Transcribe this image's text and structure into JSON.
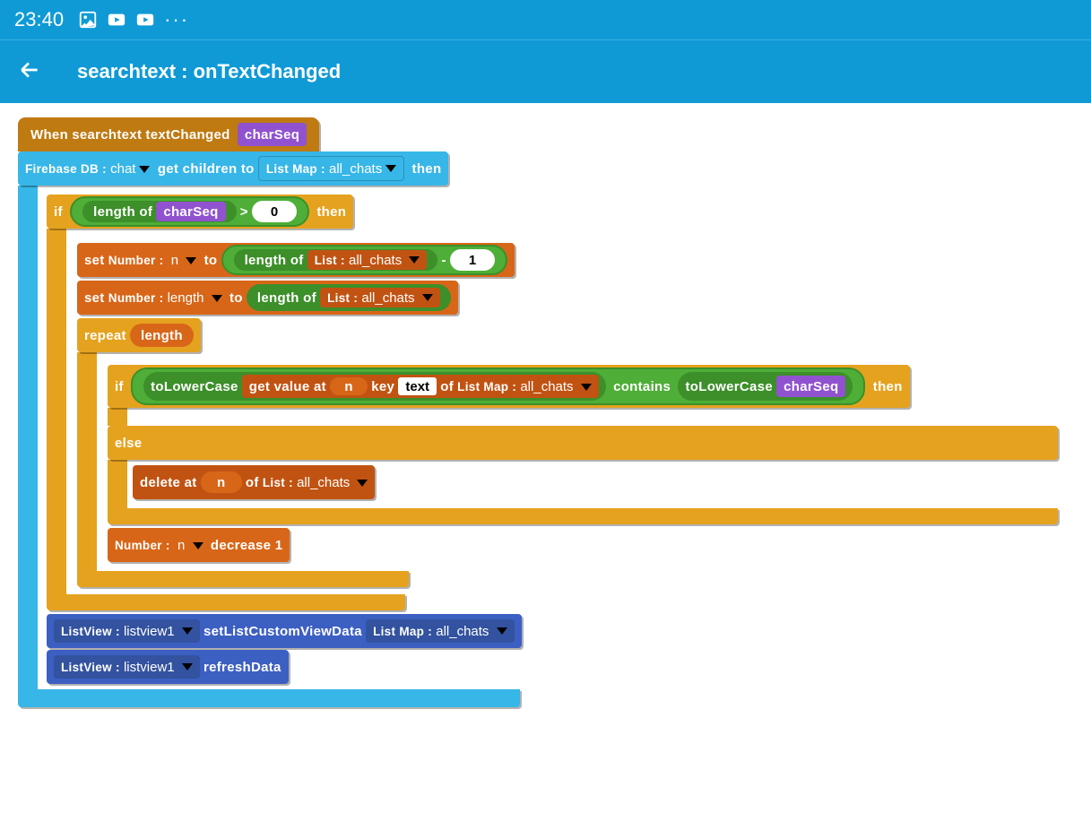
{
  "statusbar": {
    "time": "23:40"
  },
  "app": {
    "title": "searchtext : onTextChanged"
  },
  "event": {
    "when": "When",
    "component": "searchtext",
    "eventName": "textChanged",
    "param": "charSeq"
  },
  "firebase": {
    "prefix": "Firebase DB :",
    "dbName": "chat",
    "action": "get children to",
    "mapPrefix": "List Map :",
    "mapVar": "all_chats",
    "then": "then"
  },
  "ifBlock": {
    "if": "if",
    "then": "then",
    "lenLabel": "length of",
    "charSeq": "charSeq",
    "gt": ">",
    "zero": "0"
  },
  "setN": {
    "set": "set",
    "numPrefix": "Number :",
    "varN": "n",
    "to": "to",
    "lenLabel": "length of",
    "listPrefix": "List :",
    "listVar": "all_chats",
    "minus": "-",
    "one": "1"
  },
  "setLen": {
    "set": "set",
    "numPrefix": "Number :",
    "varLen": "length",
    "to": "to",
    "lenLabel": "length of",
    "listPrefix": "List :",
    "listVar": "all_chats"
  },
  "repeat": {
    "repeat": "repeat",
    "var": "length"
  },
  "innerIf": {
    "if": "if",
    "then": "then",
    "toLower": "toLowerCase",
    "getVal": "get value at",
    "n": "n",
    "key": "key",
    "text": "text",
    "of": "of",
    "mapPrefix": "List Map :",
    "mapVar": "all_chats",
    "contains": "contains",
    "charSeq": "charSeq",
    "else": "else"
  },
  "deleteBlk": {
    "delete": "delete at",
    "n": "n",
    "of": "of",
    "listPrefix": "List :",
    "listVar": "all_chats"
  },
  "decBlk": {
    "numPrefix": "Number :",
    "varN": "n",
    "decrease": "decrease 1"
  },
  "lv1": {
    "prefix": "ListView :",
    "name": "listview1",
    "action": "setListCustomViewData",
    "mapPrefix": "List Map :",
    "mapVar": "all_chats"
  },
  "lv2": {
    "prefix": "ListView :",
    "name": "listview1",
    "action": "refreshData"
  }
}
